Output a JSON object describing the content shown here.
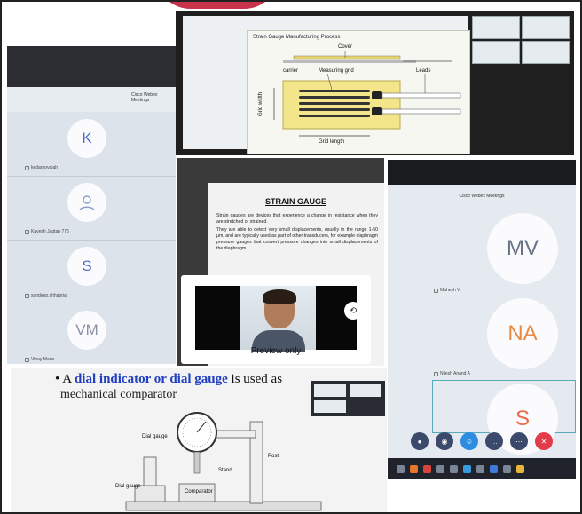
{
  "slide_manufacturing": {
    "title": "Strain Gauge Manufacturing Process",
    "labels": {
      "cover": "Cover",
      "carrier": "carrier",
      "measuring_grid": "Measuring grid",
      "leads": "Leads",
      "grid_width": "Grid width",
      "grid_length": "Grid length"
    }
  },
  "slide_strain_gauge": {
    "title": "STRAIN GAUGE",
    "bullets": [
      "Strain gauges are devices that experience a change in resistance when they are stretched or strained.",
      "They are able to detect very small displacements, usually in the range 1-50 μm, and are typically used as part of other transducers, for example diaphragm pressure gauges that convert pressure changes into small displacements of the diaphragm."
    ]
  },
  "preview": {
    "label": "Preview only"
  },
  "left_meeting": {
    "title": "Cisco Webex Meetings",
    "participants": [
      {
        "initials": "K",
        "name": "kedarpovaiah"
      },
      {
        "initials": "",
        "name": "Kavesh Jagtap 775"
      },
      {
        "initials": "S",
        "name": "sandeep.chhabria"
      },
      {
        "initials": "VM",
        "name": "Vinay Mane"
      }
    ]
  },
  "right_meeting": {
    "title": "Cisco Webex Meetings",
    "participants": [
      {
        "initials": "MV",
        "name": "Mahesh V"
      },
      {
        "initials": "NA",
        "name": "Nilesh Anand A"
      },
      {
        "initials": "S",
        "name": ""
      }
    ]
  },
  "slide_dial": {
    "heading_bullet": "•",
    "heading_a": "A ",
    "heading_term": "dial indicator or dial gauge",
    "heading_rest": " is used as",
    "subheading": "mechanical comparator",
    "labels": {
      "dial_gauge": "Dial gauge",
      "post": "Post",
      "stand": "Stand",
      "dial_gauge_base": "Dial gauge",
      "comparator": "Comparator"
    }
  },
  "colors": {
    "accent_red": "#c8324a",
    "avatar_text": "#4d6dc0",
    "webex_blue": "#2d8ce0",
    "end_red": "#e23b4a"
  }
}
